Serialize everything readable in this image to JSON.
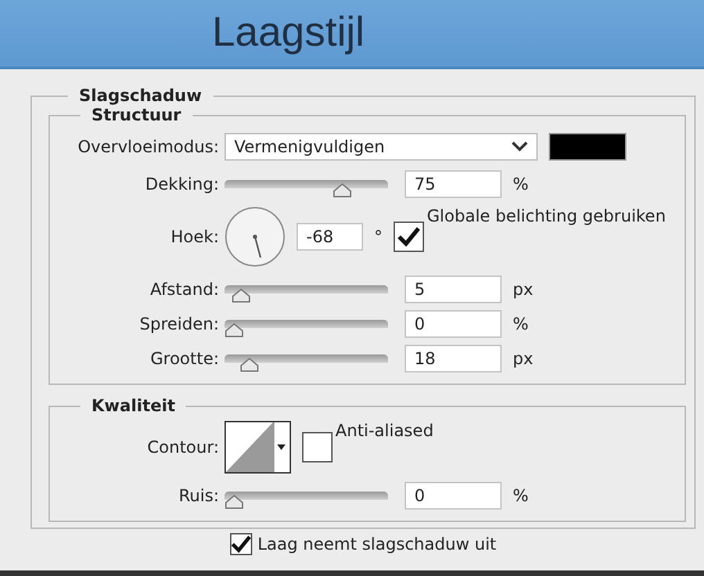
{
  "window": {
    "title": "Laagstijl"
  },
  "panel": {
    "title": "Slagschaduw"
  },
  "structure": {
    "title": "Structuur",
    "blend_mode": {
      "label": "Overvloeimodus:",
      "value": "Vermenigvuldigen",
      "color": "#000000"
    },
    "rows": [
      {
        "kind": "slider",
        "label": "Dekking:",
        "value": "75",
        "unit": "%",
        "level": 0.75
      },
      {
        "kind": "angle",
        "label": "Hoek:",
        "value": "-68",
        "unit": "°",
        "checkbox": {
          "label": "Globale belichting gebruiken",
          "checked": true
        }
      },
      {
        "kind": "slider",
        "label": "Afstand:",
        "value": "5",
        "unit": "px",
        "level": 0.05
      },
      {
        "kind": "slider",
        "label": "Spreiden:",
        "value": "0",
        "unit": "%",
        "level": 0
      },
      {
        "kind": "slider",
        "label": "Grootte:",
        "value": "18",
        "unit": "px",
        "level": 0.11
      }
    ]
  },
  "quality": {
    "title": "Kwaliteit",
    "contour": {
      "label": "Contour:"
    },
    "anti_aliased": {
      "label": "Anti-aliased",
      "checked": false
    },
    "rows": [
      {
        "kind": "slider",
        "label": "Ruis:",
        "value": "0",
        "unit": "%",
        "level": 0
      }
    ]
  },
  "footer_checkbox": {
    "label": "Laag neemt slagschaduw uit",
    "checked": true
  }
}
